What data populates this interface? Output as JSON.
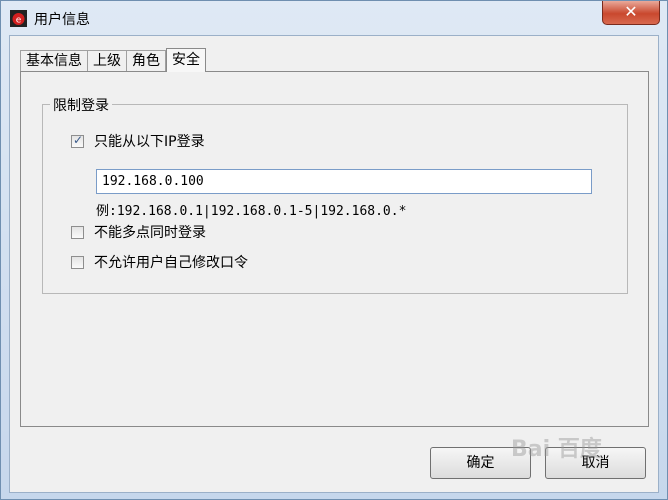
{
  "window": {
    "title": "用户信息",
    "close_glyph": "✕"
  },
  "tabs": [
    {
      "label": "基本信息"
    },
    {
      "label": "上级"
    },
    {
      "label": "角色"
    },
    {
      "label": "安全",
      "active": true
    }
  ],
  "restrict_login": {
    "group_title": "限制登录",
    "only_ip_label": "只能从以下IP登录",
    "only_ip_checked": true,
    "ip_value": "192.168.0.100",
    "example_text": "例:192.168.0.1|192.168.0.1-5|192.168.0.*",
    "no_multi_label": "不能多点同时登录",
    "no_multi_checked": false,
    "no_change_pwd_label": "不允许用户自己修改口令",
    "no_change_pwd_checked": false
  },
  "buttons": {
    "ok": "确定",
    "cancel": "取消"
  },
  "watermark": "Bai 百度",
  "colors": {
    "close_button": "#c9482e",
    "titlebar": "#dfe9f5",
    "panel": "#f0f0f0"
  }
}
